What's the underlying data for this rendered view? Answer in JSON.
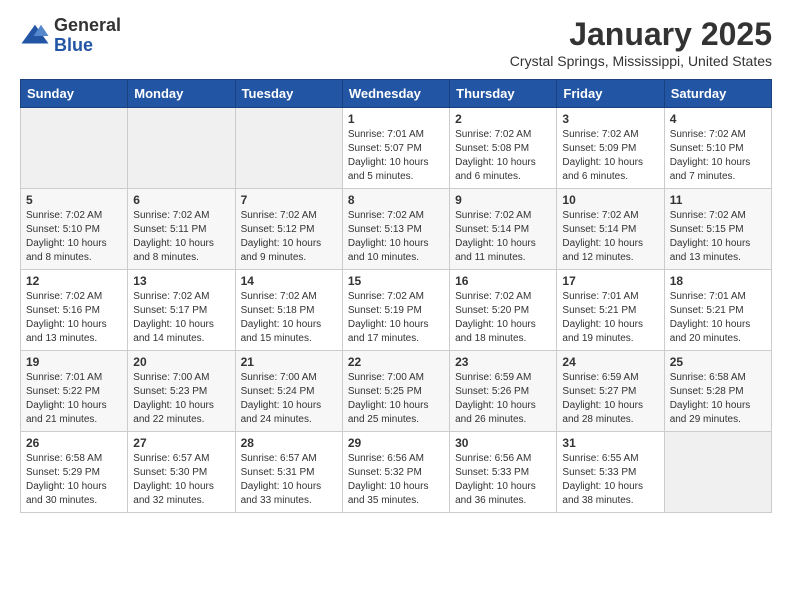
{
  "header": {
    "logo_general": "General",
    "logo_blue": "Blue",
    "month_title": "January 2025",
    "location": "Crystal Springs, Mississippi, United States"
  },
  "days_of_week": [
    "Sunday",
    "Monday",
    "Tuesday",
    "Wednesday",
    "Thursday",
    "Friday",
    "Saturday"
  ],
  "weeks": [
    [
      {
        "day": "",
        "content": ""
      },
      {
        "day": "",
        "content": ""
      },
      {
        "day": "",
        "content": ""
      },
      {
        "day": "1",
        "content": "Sunrise: 7:01 AM\nSunset: 5:07 PM\nDaylight: 10 hours\nand 5 minutes."
      },
      {
        "day": "2",
        "content": "Sunrise: 7:02 AM\nSunset: 5:08 PM\nDaylight: 10 hours\nand 6 minutes."
      },
      {
        "day": "3",
        "content": "Sunrise: 7:02 AM\nSunset: 5:09 PM\nDaylight: 10 hours\nand 6 minutes."
      },
      {
        "day": "4",
        "content": "Sunrise: 7:02 AM\nSunset: 5:10 PM\nDaylight: 10 hours\nand 7 minutes."
      }
    ],
    [
      {
        "day": "5",
        "content": "Sunrise: 7:02 AM\nSunset: 5:10 PM\nDaylight: 10 hours\nand 8 minutes."
      },
      {
        "day": "6",
        "content": "Sunrise: 7:02 AM\nSunset: 5:11 PM\nDaylight: 10 hours\nand 8 minutes."
      },
      {
        "day": "7",
        "content": "Sunrise: 7:02 AM\nSunset: 5:12 PM\nDaylight: 10 hours\nand 9 minutes."
      },
      {
        "day": "8",
        "content": "Sunrise: 7:02 AM\nSunset: 5:13 PM\nDaylight: 10 hours\nand 10 minutes."
      },
      {
        "day": "9",
        "content": "Sunrise: 7:02 AM\nSunset: 5:14 PM\nDaylight: 10 hours\nand 11 minutes."
      },
      {
        "day": "10",
        "content": "Sunrise: 7:02 AM\nSunset: 5:14 PM\nDaylight: 10 hours\nand 12 minutes."
      },
      {
        "day": "11",
        "content": "Sunrise: 7:02 AM\nSunset: 5:15 PM\nDaylight: 10 hours\nand 13 minutes."
      }
    ],
    [
      {
        "day": "12",
        "content": "Sunrise: 7:02 AM\nSunset: 5:16 PM\nDaylight: 10 hours\nand 13 minutes."
      },
      {
        "day": "13",
        "content": "Sunrise: 7:02 AM\nSunset: 5:17 PM\nDaylight: 10 hours\nand 14 minutes."
      },
      {
        "day": "14",
        "content": "Sunrise: 7:02 AM\nSunset: 5:18 PM\nDaylight: 10 hours\nand 15 minutes."
      },
      {
        "day": "15",
        "content": "Sunrise: 7:02 AM\nSunset: 5:19 PM\nDaylight: 10 hours\nand 17 minutes."
      },
      {
        "day": "16",
        "content": "Sunrise: 7:02 AM\nSunset: 5:20 PM\nDaylight: 10 hours\nand 18 minutes."
      },
      {
        "day": "17",
        "content": "Sunrise: 7:01 AM\nSunset: 5:21 PM\nDaylight: 10 hours\nand 19 minutes."
      },
      {
        "day": "18",
        "content": "Sunrise: 7:01 AM\nSunset: 5:21 PM\nDaylight: 10 hours\nand 20 minutes."
      }
    ],
    [
      {
        "day": "19",
        "content": "Sunrise: 7:01 AM\nSunset: 5:22 PM\nDaylight: 10 hours\nand 21 minutes."
      },
      {
        "day": "20",
        "content": "Sunrise: 7:00 AM\nSunset: 5:23 PM\nDaylight: 10 hours\nand 22 minutes."
      },
      {
        "day": "21",
        "content": "Sunrise: 7:00 AM\nSunset: 5:24 PM\nDaylight: 10 hours\nand 24 minutes."
      },
      {
        "day": "22",
        "content": "Sunrise: 7:00 AM\nSunset: 5:25 PM\nDaylight: 10 hours\nand 25 minutes."
      },
      {
        "day": "23",
        "content": "Sunrise: 6:59 AM\nSunset: 5:26 PM\nDaylight: 10 hours\nand 26 minutes."
      },
      {
        "day": "24",
        "content": "Sunrise: 6:59 AM\nSunset: 5:27 PM\nDaylight: 10 hours\nand 28 minutes."
      },
      {
        "day": "25",
        "content": "Sunrise: 6:58 AM\nSunset: 5:28 PM\nDaylight: 10 hours\nand 29 minutes."
      }
    ],
    [
      {
        "day": "26",
        "content": "Sunrise: 6:58 AM\nSunset: 5:29 PM\nDaylight: 10 hours\nand 30 minutes."
      },
      {
        "day": "27",
        "content": "Sunrise: 6:57 AM\nSunset: 5:30 PM\nDaylight: 10 hours\nand 32 minutes."
      },
      {
        "day": "28",
        "content": "Sunrise: 6:57 AM\nSunset: 5:31 PM\nDaylight: 10 hours\nand 33 minutes."
      },
      {
        "day": "29",
        "content": "Sunrise: 6:56 AM\nSunset: 5:32 PM\nDaylight: 10 hours\nand 35 minutes."
      },
      {
        "day": "30",
        "content": "Sunrise: 6:56 AM\nSunset: 5:33 PM\nDaylight: 10 hours\nand 36 minutes."
      },
      {
        "day": "31",
        "content": "Sunrise: 6:55 AM\nSunset: 5:33 PM\nDaylight: 10 hours\nand 38 minutes."
      },
      {
        "day": "",
        "content": ""
      }
    ]
  ]
}
